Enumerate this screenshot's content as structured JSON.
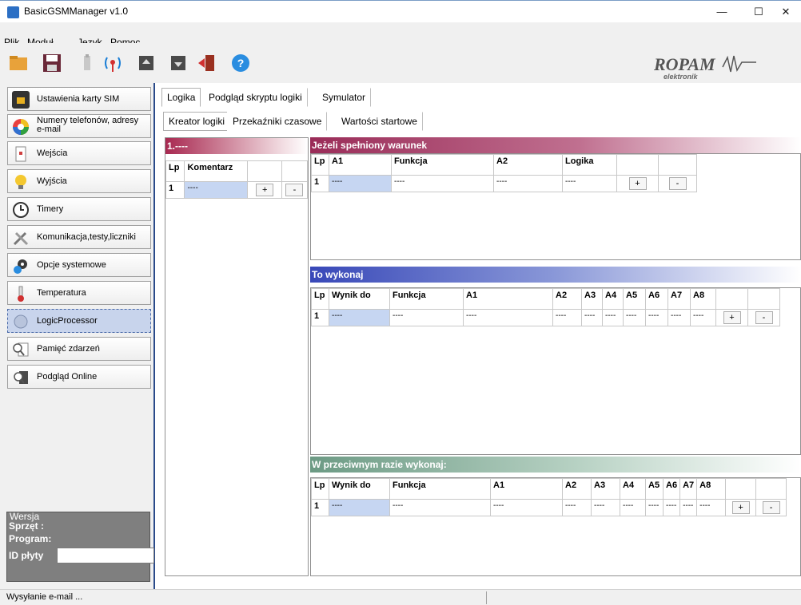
{
  "window": {
    "title": "BasicGSMManager v1.0",
    "controls": {
      "minimize": "—",
      "maximize": "☐",
      "close": "✕"
    }
  },
  "menu": [
    {
      "label": "Plik",
      "underline": "P",
      "rest": "lik"
    },
    {
      "label": "Moduł",
      "underline": "M",
      "rest": "oduł"
    },
    {
      "label": "Język",
      "underline": "J",
      "rest": "ęzyk"
    },
    {
      "label": "Pomoc",
      "underline": "o",
      "pre": "P",
      "rest": "moc"
    }
  ],
  "toolbar": {
    "icons": [
      "folder-open-icon",
      "save-icon",
      "usb-icon",
      "antenna-icon",
      "chip-upload-icon",
      "chip-download-icon",
      "exit-icon",
      "help-icon"
    ],
    "help_glyph": "?"
  },
  "brand": {
    "name": "ROPAM",
    "sub": "elektronik"
  },
  "sidebar": {
    "items": [
      {
        "label": "Ustawienia karty SIM",
        "icon": "sim-card-icon"
      },
      {
        "label": "Numery telefonów, adresy",
        "label2": "e-mail",
        "icon": "color-wheel-icon"
      },
      {
        "label": "Wejścia",
        "icon": "input-icon"
      },
      {
        "label": "Wyjścia",
        "icon": "bulb-icon"
      },
      {
        "label": "Timery",
        "icon": "clock-icon"
      },
      {
        "label": "Komunikacja,testy,liczniki",
        "icon": "tools-icon"
      },
      {
        "label": "Opcje systemowe",
        "icon": "gears-icon"
      },
      {
        "label": "Temperatura",
        "icon": "thermometer-icon"
      },
      {
        "label": "LogicProcessor",
        "icon": "logic-icon",
        "selected": true
      },
      {
        "label": "Pamięć zdarzeń",
        "icon": "event-log-icon"
      },
      {
        "label": "Podgląd Online",
        "icon": "online-view-icon"
      }
    ]
  },
  "version": {
    "legend": "Wersja",
    "hardware_label": "Sprzęt :",
    "program_label": "Program:",
    "board_id_label": "ID płyty",
    "board_id_value": ""
  },
  "tabs": {
    "top": [
      "Logika",
      "Podgląd skryptu logiki",
      "Symulator"
    ],
    "sub": [
      "Kreator logiki",
      "Przekaźniki czasowe",
      "Wartości startowe"
    ]
  },
  "left_panel": {
    "header": "1.----",
    "columns": [
      "Lp",
      "Komentarz"
    ],
    "row": {
      "lp": "1",
      "comment": "----",
      "add": "+",
      "remove": "-"
    }
  },
  "condition": {
    "header": "Jeżeli spełniony warunek",
    "columns": [
      "Lp",
      "A1",
      "Funkcja",
      "A2",
      "Logika"
    ],
    "row": {
      "lp": "1",
      "a1": "----",
      "funkcja": "----",
      "a2": "----",
      "logika": "----",
      "add": "+",
      "remove": "-"
    }
  },
  "then": {
    "header": "To wykonaj",
    "columns": [
      "Lp",
      "Wynik do",
      "Funkcja",
      "A1",
      "A2",
      "A3",
      "A4",
      "A5",
      "A6",
      "A7",
      "A8"
    ],
    "row": {
      "lp": "1",
      "wynik": "----",
      "funkcja": "----",
      "a1": "----",
      "a2": "----",
      "a3": "----",
      "a4": "----",
      "a5": "----",
      "a6": "----",
      "a7": "----",
      "a8": "----",
      "add": "+",
      "remove": "-"
    }
  },
  "else": {
    "header": "W przeciwnym razie wykonaj:",
    "columns": [
      "Lp",
      "Wynik do",
      "Funkcja",
      "A1",
      "A2",
      "A3",
      "A4",
      "A5",
      "A6",
      "A7",
      "A8"
    ],
    "row": {
      "lp": "1",
      "wynik": "----",
      "funkcja": "----",
      "a1": "----",
      "a2": "----",
      "a3": "----",
      "a4": "----",
      "a5": "----",
      "a6": "----",
      "a7": "----",
      "a8": "----",
      "add": "+",
      "remove": "-"
    }
  },
  "status": {
    "text": "Wysyłanie e-mail ..."
  },
  "colors": {
    "left_header": "#b0285a",
    "condition_header": "#a0305c",
    "then_header": "#3a4fb8",
    "else_header": "#6f9c86"
  }
}
